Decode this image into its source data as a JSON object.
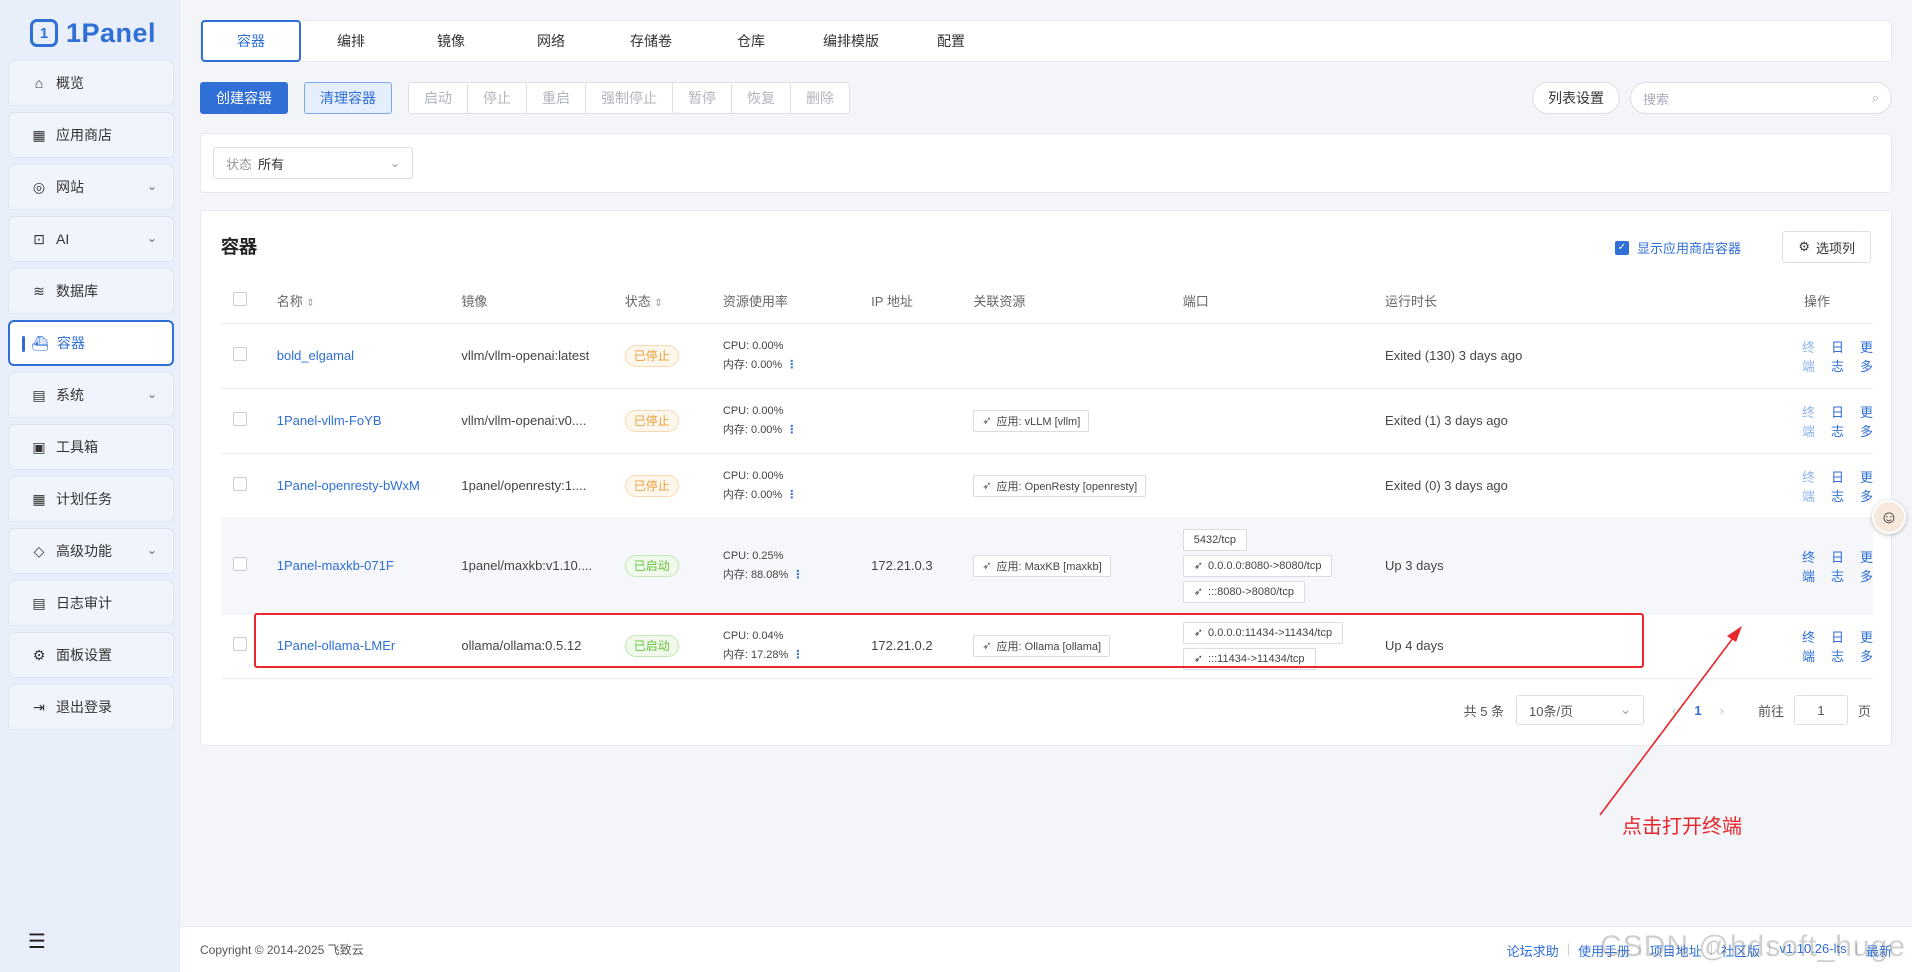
{
  "app": {
    "name": "1Panel"
  },
  "sidebar": {
    "items": [
      {
        "label": "概览",
        "icon": "home-icon",
        "glyph": "⌂"
      },
      {
        "label": "应用商店",
        "icon": "apps-grid-icon",
        "glyph": "▦"
      },
      {
        "label": "网站",
        "icon": "globe-icon",
        "glyph": "◎"
      },
      {
        "label": "AI",
        "icon": "robot-icon",
        "glyph": "⊡"
      },
      {
        "label": "数据库",
        "icon": "layers-icon",
        "glyph": "≋"
      },
      {
        "label": "容器",
        "icon": "docker-icon",
        "glyph": "⛴"
      },
      {
        "label": "系统",
        "icon": "server-icon",
        "glyph": "▤"
      },
      {
        "label": "工具箱",
        "icon": "toolbox-icon",
        "glyph": "▣"
      },
      {
        "label": "计划任务",
        "icon": "calendar-icon",
        "glyph": "▦"
      },
      {
        "label": "高级功能",
        "icon": "diamond-icon",
        "glyph": "◇"
      },
      {
        "label": "日志审计",
        "icon": "log-icon",
        "glyph": "▤"
      },
      {
        "label": "面板设置",
        "icon": "gear-icon",
        "glyph": "⚙"
      },
      {
        "label": "退出登录",
        "icon": "logout-icon",
        "glyph": "⇥"
      }
    ],
    "active": "容器"
  },
  "tabs": [
    "容器",
    "编排",
    "镜像",
    "网络",
    "存储卷",
    "仓库",
    "编排模版",
    "配置"
  ],
  "toolbar": {
    "create": "创建容器",
    "clean": "清理容器",
    "group": [
      "启动",
      "停止",
      "重启",
      "强制停止",
      "暂停",
      "恢复",
      "删除"
    ],
    "list_settings": "列表设置",
    "search_placeholder": "搜索"
  },
  "filter": {
    "prefix": "状态",
    "value": "所有"
  },
  "list": {
    "title": "容器",
    "show_store": "显示应用商店容器",
    "columns_button": "选项列",
    "columns": [
      "名称",
      "镜像",
      "状态",
      "资源使用率",
      "IP 地址",
      "关联资源",
      "端口",
      "运行时长",
      "操作"
    ],
    "rows": [
      {
        "name": "bold_elgamal",
        "image": "vllm/vllm-openai:latest",
        "status": "已停止",
        "cpu": "CPU: 0.00%",
        "mem": "内存: 0.00%",
        "ip": "",
        "relation": "",
        "ports": [],
        "uptime": "Exited (130) 3 days ago"
      },
      {
        "name": "1Panel-vllm-FoYB",
        "image": "vllm/vllm-openai:v0....",
        "status": "已停止",
        "cpu": "CPU: 0.00%",
        "mem": "内存: 0.00%",
        "ip": "",
        "relation": "应用: vLLM [vllm]",
        "ports": [],
        "uptime": "Exited (1) 3 days ago"
      },
      {
        "name": "1Panel-openresty-bWxM",
        "image": "1panel/openresty:1....",
        "status": "已停止",
        "cpu": "CPU: 0.00%",
        "mem": "内存: 0.00%",
        "ip": "",
        "relation": "应用: OpenResty [openresty]",
        "ports": [],
        "uptime": "Exited (0) 3 days ago"
      },
      {
        "name": "1Panel-maxkb-071F",
        "image": "1panel/maxkb:v1.10....",
        "status": "已启动",
        "cpu": "CPU: 0.25%",
        "mem": "内存: 88.08%",
        "ip": "172.21.0.3",
        "relation": "应用: MaxKB [maxkb]",
        "ports": [
          "5432/tcp",
          "0.0.0.0:8080->8080/tcp",
          ":::8080->8080/tcp"
        ],
        "uptime": "Up 3 days"
      },
      {
        "name": "1Panel-ollama-LMEr",
        "image": "ollama/ollama:0.5.12",
        "status": "已启动",
        "cpu": "CPU: 0.04%",
        "mem": "内存: 17.28%",
        "ip": "172.21.0.2",
        "relation": "应用: Ollama [ollama]",
        "ports": [
          "0.0.0.0:11434->11434/tcp",
          ":::11434->11434/tcp"
        ],
        "uptime": "Up 4 days"
      }
    ],
    "ops": {
      "terminal": "终端",
      "log": "日志",
      "more": "更多"
    }
  },
  "pager": {
    "total": "共 5 条",
    "size": "10条/页",
    "current": "1",
    "goto": "前往",
    "goto_value": "1",
    "page_suffix": "页"
  },
  "annotation": "点击打开终端",
  "footer": {
    "copyright": "Copyright © 2014-2025 飞致云",
    "links": [
      "论坛求助",
      "使用手册",
      "项目地址",
      "社区版",
      "v1.10.26-lts",
      "最新"
    ]
  },
  "watermark": "CSDN @hdsoft_huge",
  "colors": {
    "accent": "#2f6fd6",
    "stopped": "#e6a23c",
    "running": "#67c23a",
    "annotation": "#e8262c"
  }
}
